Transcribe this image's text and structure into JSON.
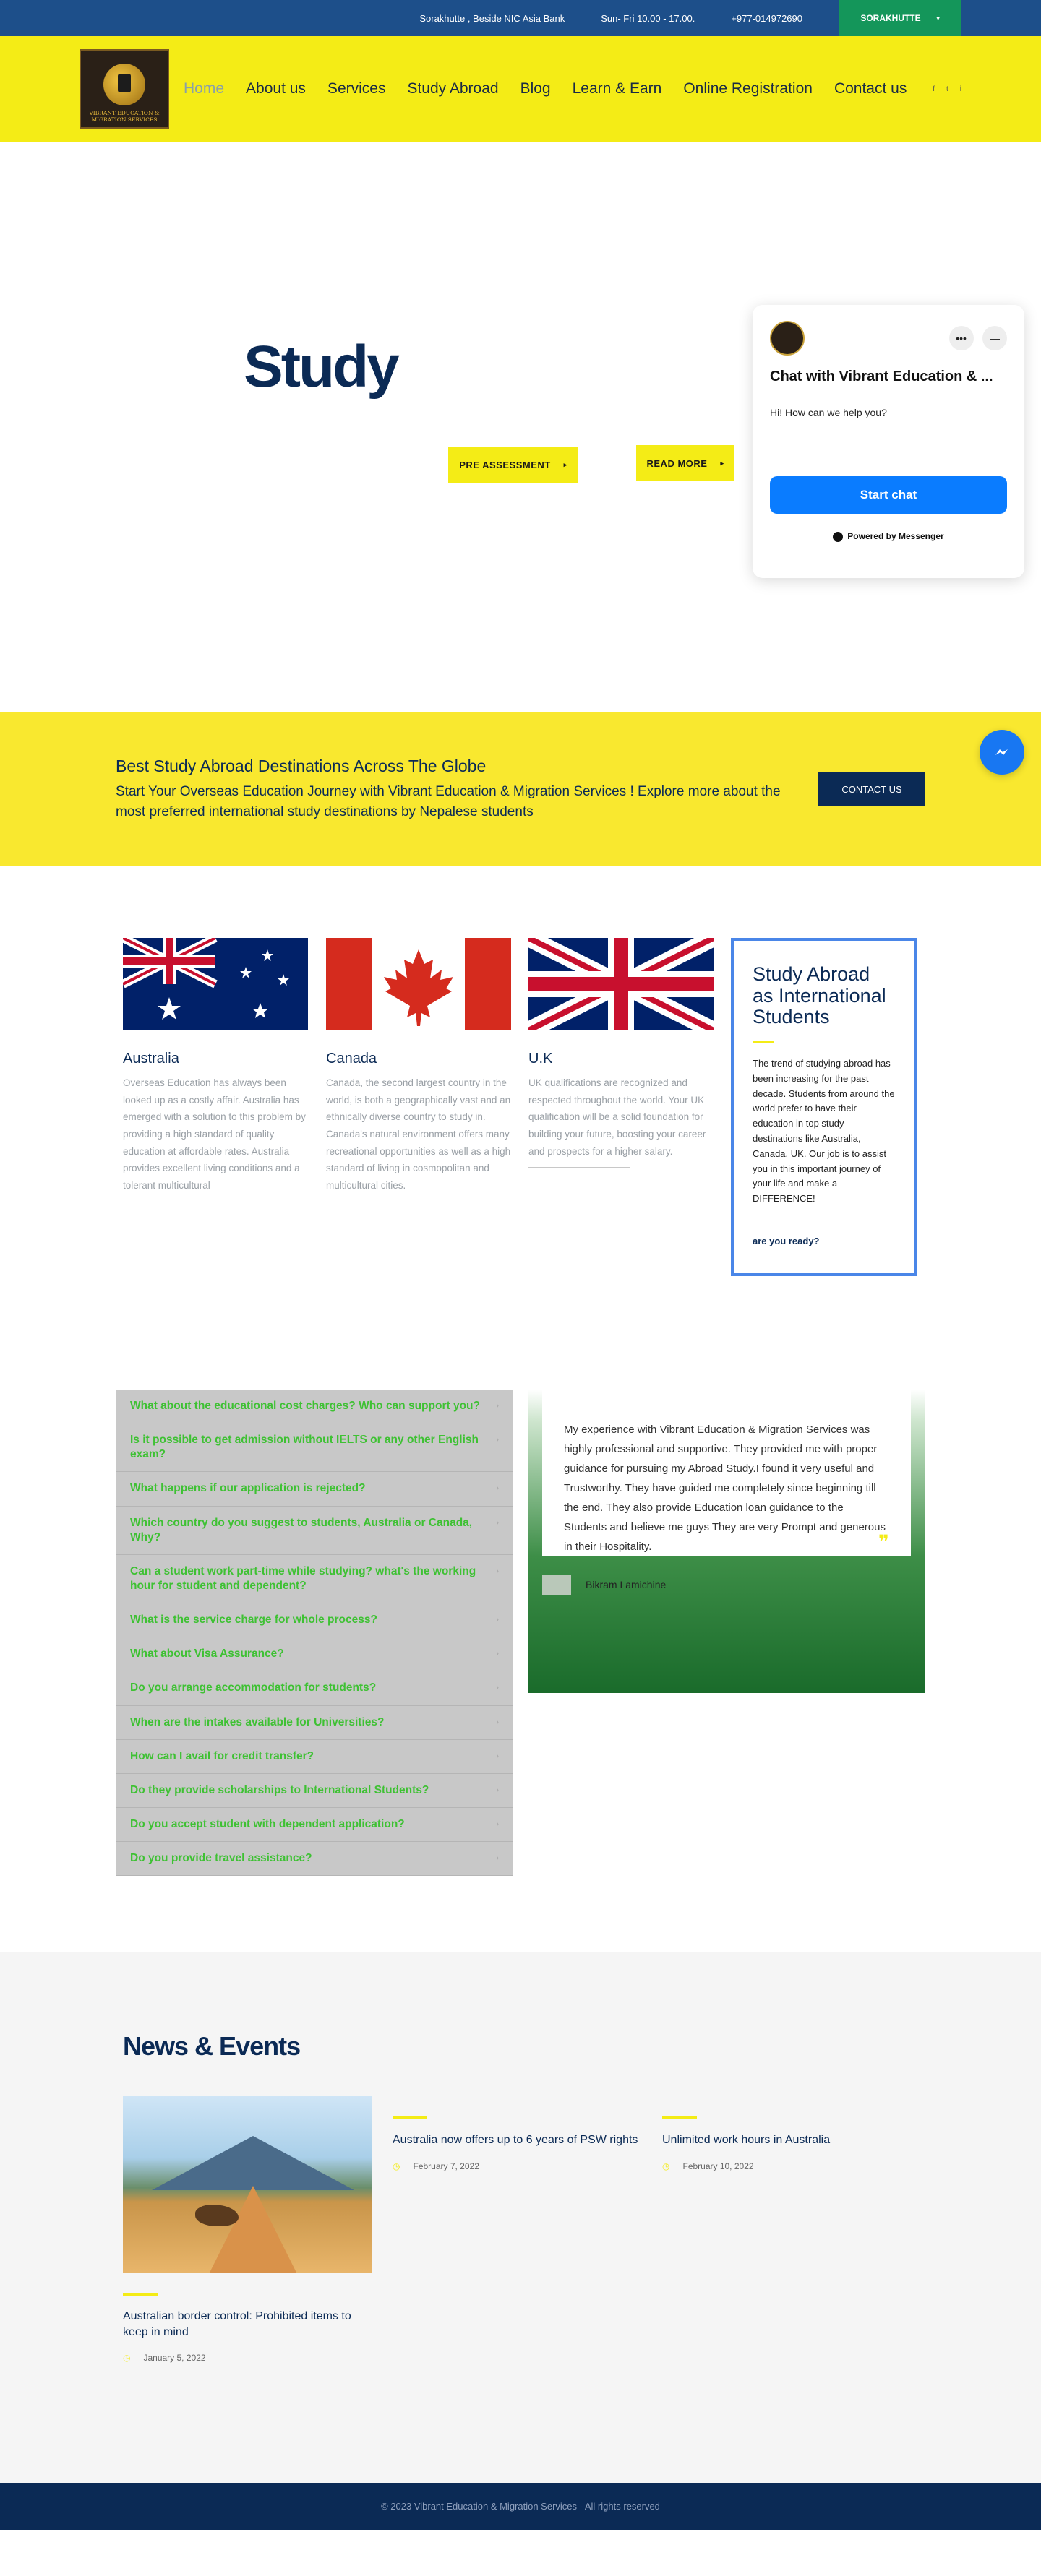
{
  "topbar": {
    "address": "Sorakhutte , Beside NIC Asia Bank",
    "hours": "Sun- Fri 10.00 - 17.00.",
    "phone": "+977-014972690",
    "branch": "SORAKHUTTE",
    "branch_caret": "▾"
  },
  "nav": {
    "logo_text": "VIBRANT EDUCATION & MIGRATION SERVICES",
    "items": [
      "Home",
      "About us",
      "Services",
      "Study Abroad",
      "Blog",
      "Learn & Earn",
      "Online Registration",
      "Contact us"
    ],
    "social": [
      "f",
      "t",
      "i"
    ]
  },
  "hero": {
    "title": "Study",
    "pre_assessment": "PRE ASSESSMENT",
    "read_more": "READ MORE"
  },
  "chat": {
    "title": "Chat with Vibrant Education & ...",
    "greeting": "Hi! How can we help you?",
    "start": "Start chat",
    "powered": "Powered by Messenger",
    "more": "•••",
    "minimize": "—"
  },
  "cta": {
    "heading": "Best Study Abroad Destinations Across The Globe",
    "text": "Start Your Overseas Education Journey with Vibrant Education & Migration Services ! Explore more about the most preferred international study destinations by Nepalese students",
    "button": "CONTACT US"
  },
  "destinations": [
    {
      "name": "Australia",
      "desc": "Overseas Education has always been looked up as a costly affair. Australia has emerged with a solution to this problem by providing a high standard of quality education at affordable rates. Australia provides excellent living conditions and a tolerant multicultural"
    },
    {
      "name": "Canada",
      "desc": "Canada, the second largest country in the world, is both a geographically vast and an ethnically diverse country to study in. Canada's natural environment offers many recreational opportunities as well as a high standard of living in cosmopolitan and multicultural cities."
    },
    {
      "name": "U.K",
      "desc": "UK qualifications are recognized and respected throughout the world. Your UK qualification will be a solid foundation for building your future, boosting your career and prospects for a higher salary."
    }
  ],
  "sidebox": {
    "title": "Study Abroad as International Students",
    "text": "The trend of studying abroad has been increasing for the past decade. Students from around the world prefer to have their education in top study destinations like Australia, Canada, UK. Our job is to assist you in this important journey of your life and make a DIFFERENCE!",
    "link": "are you ready?"
  },
  "faq": [
    "What about the educational cost charges? Who can support you?",
    "Is it possible to get admission without IELTS or any other English exam?",
    "What happens if our application is rejected?",
    "Which country do you suggest to students, Australia or Canada, Why?",
    "Can a student work part-time while studying? what's the working hour for student and dependent?",
    "What is the service charge for whole process?",
    "What about Visa Assurance?",
    "Do you arrange accommodation for students?",
    "When are the intakes available for Universities?",
    "How can I avail for credit transfer?",
    "Do they provide scholarships to International Students?",
    "Do you accept student with dependent application?",
    "Do you provide travel assistance?"
  ],
  "testimonial": {
    "quote": "My experience with Vibrant Education & Migration Services was highly professional and supportive. They provided me with proper guidance for pursuing my Abroad Study.I found it very useful and Trustworthy. They have guided me completely since beginning till the end. They also provide Education loan guidance to the Students and believe me guys They are very Prompt and generous in their Hospitality.",
    "author": "Bikram Lamichine"
  },
  "news": {
    "heading": "News & Events",
    "items": [
      {
        "title": "Australian border control: Prohibited items to keep in mind",
        "date": "January 5, 2022"
      },
      {
        "title": "Australia now offers up to 6 years of PSW rights",
        "date": "February 7, 2022"
      },
      {
        "title": "Unlimited work hours in Australia",
        "date": "February 10, 2022"
      }
    ]
  },
  "footer": {
    "copyright": "© 2023 Vibrant Education & Migration Services - All rights reserved"
  }
}
